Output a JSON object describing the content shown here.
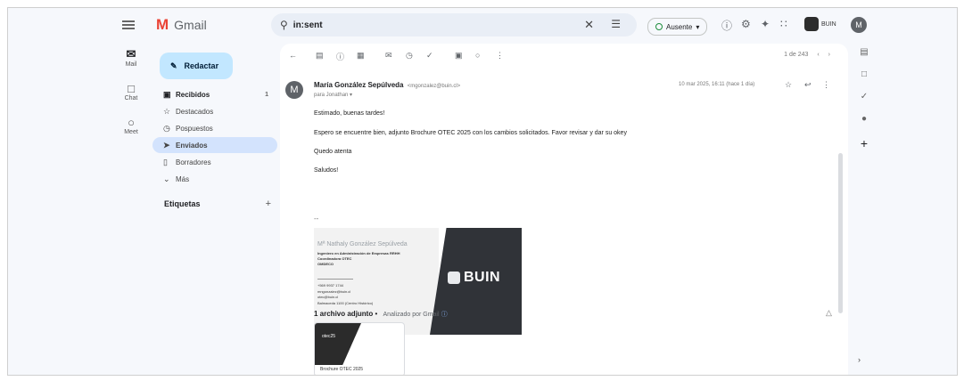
{
  "app": {
    "name": "Gmail"
  },
  "search": {
    "query": "in:sent"
  },
  "status": {
    "label": "Ausente"
  },
  "brand": {
    "name": "BUIN"
  },
  "account": {
    "initial": "M"
  },
  "rail": [
    {
      "label": "Mail",
      "icon": "mail-icon"
    },
    {
      "label": "Chat",
      "icon": "chat-icon"
    },
    {
      "label": "Meet",
      "icon": "meet-icon"
    }
  ],
  "compose": {
    "label": "Redactar"
  },
  "nav": [
    {
      "label": "Recibidos",
      "icon": "inbox-icon",
      "count": "1"
    },
    {
      "label": "Destacados",
      "icon": "star-icon",
      "count": ""
    },
    {
      "label": "Pospuestos",
      "icon": "snooze-icon",
      "count": ""
    },
    {
      "label": "Enviados",
      "icon": "send-icon",
      "count": "",
      "active": true
    },
    {
      "label": "Borradores",
      "icon": "draft-icon",
      "count": ""
    },
    {
      "label": "Más",
      "icon": "chevron-down-icon",
      "count": ""
    }
  ],
  "labels": {
    "title": "Etiquetas"
  },
  "message": {
    "sender_initial": "M",
    "sender_name": "María González Sepúlveda",
    "sender_email": "<mgonzalez@buin.cl>",
    "to": "para Jonathan",
    "date": "10 mar 2025, 16:11 (hace 1 día)",
    "paragraphs": [
      "Estimado, buenas tardes!",
      "Espero se encuentre bien, adjunto Brochure OTEC 2025 con los cambios solicitados. Favor revisar y dar su okey",
      "Quedo atenta",
      "Saludos!"
    ],
    "sig_separator": "--"
  },
  "signature": {
    "name": "Mª Nathaly González Sepúlveda",
    "lines": [
      "Ingeniero en Administración de Empresas RRHH",
      "Coordinadora OTEC",
      "OMDECO",
      "+569 9937 1744",
      "mngonzalez@buin.cl",
      "otec@buin.cl",
      "Balmaceda 1100 (Centro Histórico)"
    ],
    "logo_text": "BUIN"
  },
  "attachments": {
    "header": "1 archivo adjunto",
    "scanned": "Analizado por Gmail",
    "file_thumb_label": "otec25",
    "file_name": "Brochure OTEC 2025"
  },
  "pager": {
    "text": "1 de 243"
  }
}
